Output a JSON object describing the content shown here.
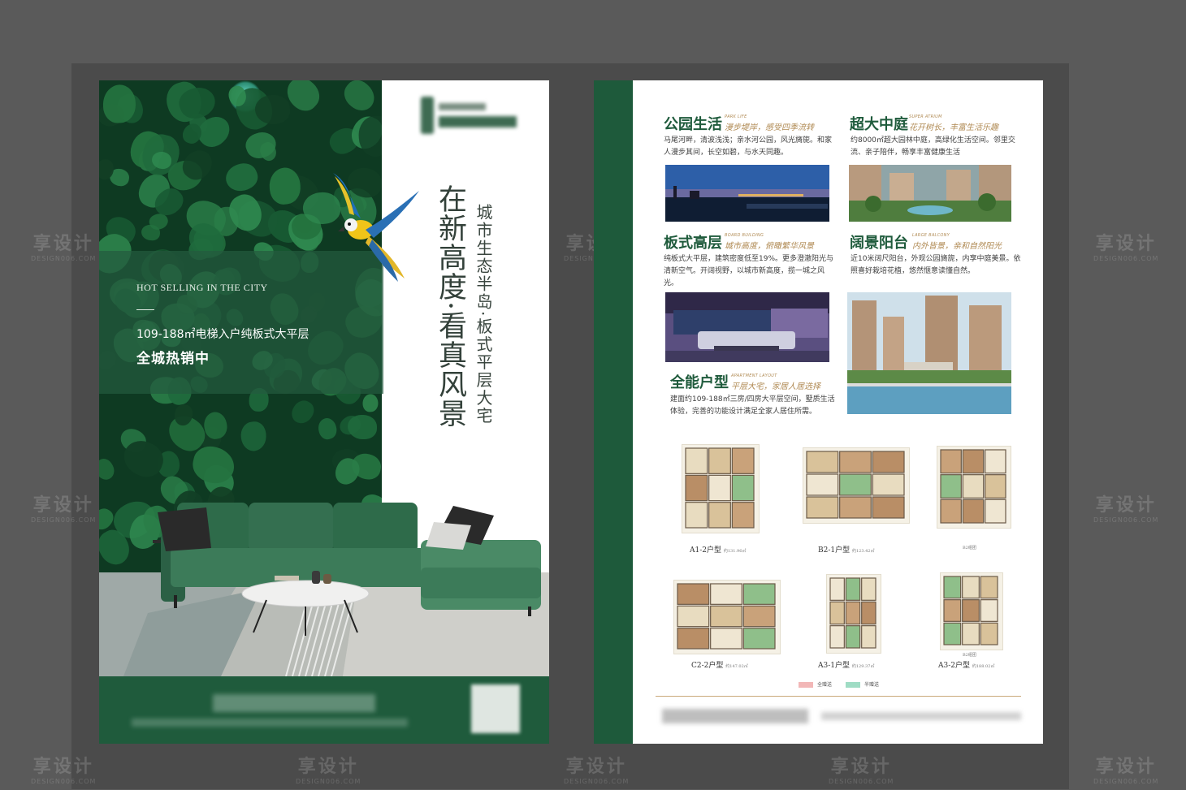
{
  "watermark": {
    "brand": "享设计",
    "site": "DESIGN006.COM"
  },
  "left_page": {
    "hot_selling": "HOT SELLING IN THE CITY",
    "area_line": "109-188㎡电梯入户纯板式大平层",
    "on_sale": "全城热销中",
    "headline": "在新高度·看真风景",
    "subline": "城市生态半岛·板式平层大宅"
  },
  "right_page": {
    "sections": [
      {
        "title": "公园生活",
        "en": "PARK LIFE",
        "subtitle": "漫步堤岸，感受四季流转",
        "body": "马尾河畔，清波浅浅；亲水河公园，风光旖旎。和家人漫步其间，长空如碧，与水天同趣。"
      },
      {
        "title": "超大中庭",
        "en": "SUPER ATRIUM",
        "subtitle": "花开树长，丰富生活乐趣",
        "body": "约8000㎡超大园林中庭，高绿化生活空间。邻里交流、亲子陪伴，畅享丰富健康生活"
      },
      {
        "title": "板式高层",
        "en": "BOARD BUILDING",
        "subtitle": "城市高度，俯瞰繁华风景",
        "body": "纯板式大平层，建筑密度低至19%。更多澄澈阳光与清新空气。开阔视野，以城市新高度，揽一城之风光。"
      },
      {
        "title": "阔景阳台",
        "en": "LARGE BALCONY",
        "subtitle": "内外皆景，亲和自然阳光",
        "body": "近10米阔尺阳台，外观公园旖旎，内享中庭美景。依照喜好栽培花植，悠然惬意读懂自然。"
      },
      {
        "title": "全能户型",
        "en": "APARTMENT LAYOUT",
        "subtitle": "平层大宅，家居人居选择",
        "body": "建面约109-188㎡三房/四房大平层空间，墅质生活体验，完善的功能设计满足全家人居住所需。"
      }
    ],
    "plans": [
      {
        "name": "A1-2户型",
        "area": "约131.96㎡"
      },
      {
        "name": "B2-1户型",
        "area": "约123.42㎡"
      },
      {
        "name": "",
        "area": "",
        "tag": "B2组团"
      },
      {
        "name": "C2-2户型",
        "area": "约147.02㎡"
      },
      {
        "name": "A3-1户型",
        "area": "约129.37㎡"
      },
      {
        "name": "A3-2户型",
        "area": "约188.02㎡",
        "tag": "B2组团"
      }
    ],
    "legend": {
      "full_gift": "全赠送",
      "half_gift": "半赠送"
    }
  },
  "colors": {
    "brand_green": "#1f5b3c",
    "accent_gold": "#b08a53",
    "full_gift": "#f2b7b7",
    "half_gift": "#9fdcc4"
  }
}
